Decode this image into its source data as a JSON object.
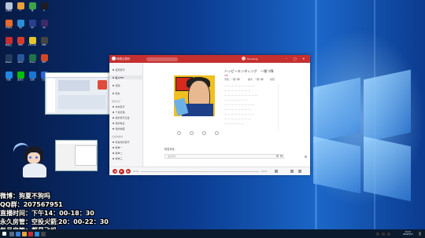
{
  "desktop": {
    "icons": [
      {
        "label": "回收站",
        "color": "#b7c7d9"
      },
      {
        "label": "2",
        "color": "#e8a13a"
      },
      {
        "label": "微",
        "color": "#3aa54a"
      },
      {
        "label": "A",
        "color": "#1d1d1d"
      },
      {
        "label": "Firefox",
        "color": "#e66a2c"
      },
      {
        "label": "QQ",
        "color": "#2a8fd6"
      },
      {
        "label": "PS",
        "color": "#2a3f8a"
      },
      {
        "label": "AE",
        "color": "#3a2a6a"
      },
      {
        "label": "网易云",
        "color": "#c62f2f"
      },
      {
        "label": "WPS",
        "color": "#d83b2c"
      },
      {
        "label": "Chrome",
        "color": "#e7c52f"
      },
      {
        "label": "OBS",
        "color": "#444444"
      },
      {
        "label": "Steam",
        "color": "#233a5c"
      },
      {
        "label": "Word",
        "color": "#2b579a"
      },
      {
        "label": "Excel",
        "color": "#217346"
      },
      {
        "label": "PPT",
        "color": "#d24726"
      },
      {
        "label": "优酷",
        "color": "#1e88e5"
      },
      {
        "label": "爱奇艺",
        "color": "#00be06"
      },
      {
        "label": "迅雷",
        "color": "#1a76d2"
      },
      {
        "label": "百度",
        "color": "#2f63d9"
      }
    ]
  },
  "overlay": {
    "lines": [
      "微博：狗夏不狗吗",
      "QQ群：207567951",
      "直播时间：下午14：00-18：30",
      "晚上20：00-22：30",
      "永久房管：空投火箭",
      "每月房管：都是飞机"
    ]
  },
  "app": {
    "title": "网易云音乐",
    "account": "Hyuaeng",
    "nav": {
      "items_top": [
        "发现音乐",
        "私人FM",
        "视频",
        "朋友"
      ],
      "group_mine": "我的音乐",
      "items_mine": [
        "本地音乐",
        "下载管理",
        "我的音乐云盘",
        "我的电台",
        "我的收藏"
      ],
      "group_playlists": "创建的歌单",
      "items_playlists": [
        "我喜欢的音乐",
        "歌单一",
        "歌单二",
        "歌单三"
      ]
    },
    "song": {
      "title": "ハッピーエンディング　一服つ隊",
      "tag": "VIP",
      "album_line": "专辑：一服つ隊",
      "artist_line": "歌手：一服つ隊",
      "source_line": "来源：",
      "lyrics": [
        "― ― ― ― ― ― ― ― ―",
        "― ― ― ― ― ― ― ―",
        "― ― ― ― ― ― ― ― ― ―",
        "― ― ― ― ― ― ―",
        "― ― ― ― ― ― ― ― ―",
        "― ― ― ― ― ― ― ―",
        "― ― ― ― ― ― ― ― ―",
        "― ― ― ― ― ― ― ―",
        "― ― ― ― ― ―"
      ]
    },
    "comments": {
      "title": "听友评论",
      "placeholder": "发表评论"
    },
    "player": {
      "time_current": "00:00",
      "time_total": "03:05"
    }
  },
  "taskbar": {
    "time": "22:12",
    "date": "2019/5/17"
  },
  "colors": {
    "accent": "#c62f2f",
    "taskbar": "#0b1a2d"
  }
}
